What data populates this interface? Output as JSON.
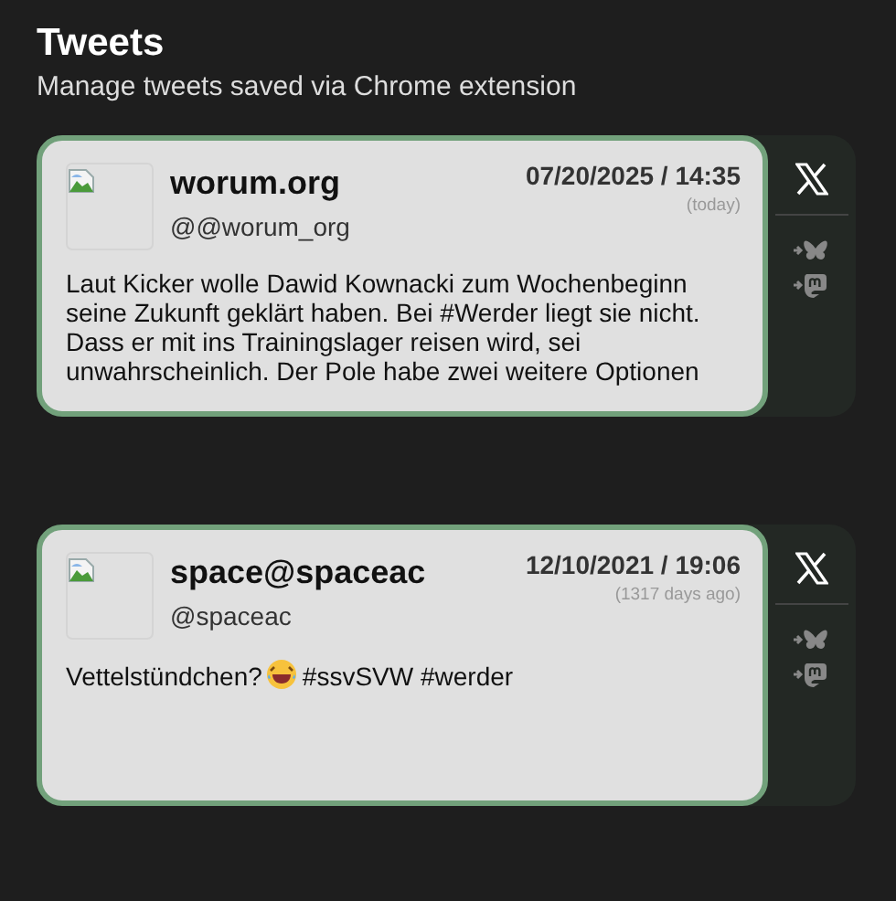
{
  "header": {
    "title": "Tweets",
    "subtitle": "Manage tweets saved via Chrome extension"
  },
  "tweets": [
    {
      "name": "worum.org",
      "handle": "@@worum_org",
      "date": "07/20/2025 / 14:35",
      "relative": "(today)",
      "lines": [
        {
          "kind": "text",
          "text": "Laut Kicker wolle Dawid Kownacki zum Wochenbeginn seine Zukunft geklärt haben. Bei #Werder liegt sie nicht. Dass er mit ins Trainingslager reisen wird, sei unwahrscheinlich. Der Pole habe zwei weitere Optionen"
        }
      ]
    },
    {
      "name": "space@spaceac",
      "handle": "@spaceac",
      "date": "12/10/2021 / 19:06",
      "relative": "(1317 days ago)",
      "lines": [
        {
          "kind": "text",
          "text": "Vettelstündchen?"
        },
        {
          "kind": "emoji"
        },
        {
          "kind": "text",
          "text": "#ssvSVW #werder"
        }
      ]
    }
  ]
}
